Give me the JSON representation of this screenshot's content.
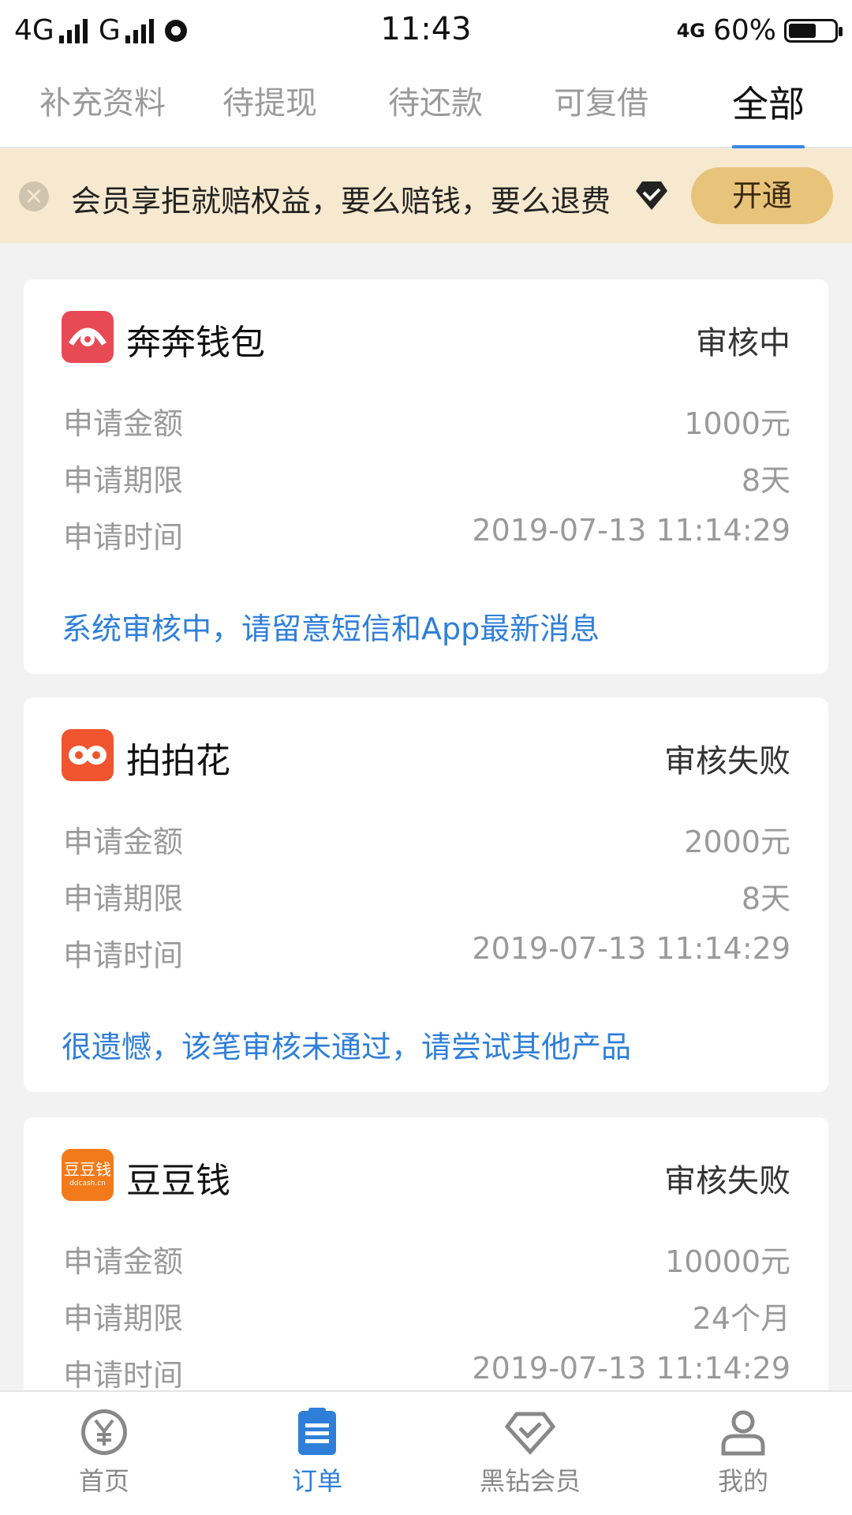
{
  "status_bar": {
    "network_left": "4G",
    "network_mid": "G",
    "time": "11:43",
    "network_right": "4G",
    "battery": "60%",
    "battery_level": 0.6
  },
  "tabs": [
    {
      "label": "补充资料",
      "active": false
    },
    {
      "label": "待提现",
      "active": false
    },
    {
      "label": "待还款",
      "active": false
    },
    {
      "label": "可复借",
      "active": false
    },
    {
      "label": "全部",
      "active": true
    }
  ],
  "banner": {
    "text": "会员享拒就赔权益，要么赔钱，要么退费",
    "button": "开通",
    "close_icon": "close-icon",
    "diamond_icon": "diamond-icon"
  },
  "orders": [
    {
      "name": "奔奔钱包",
      "status": "审核中",
      "logo_color": "#e84a55",
      "rows": [
        {
          "label": "申请金额",
          "value": "1000元"
        },
        {
          "label": "申请期限",
          "value": "8天"
        },
        {
          "label": "申请时间",
          "value": "2019-07-13 11:14:29"
        }
      ],
      "message": "系统审核中，请留意短信和App最新消息"
    },
    {
      "name": "拍拍花",
      "status": "审核失败",
      "logo_color": "#f0552f",
      "rows": [
        {
          "label": "申请金额",
          "value": "2000元"
        },
        {
          "label": "申请期限",
          "value": "8天"
        },
        {
          "label": "申请时间",
          "value": "2019-07-13 11:14:29"
        }
      ],
      "message": "很遗憾，该笔审核未通过，请尝试其他产品"
    },
    {
      "name": "豆豆钱",
      "status": "审核失败",
      "logo_color": "#f27a1a",
      "logo_text": "豆豆钱",
      "logo_subtext": "ddcash.cn",
      "rows": [
        {
          "label": "申请金额",
          "value": "10000元"
        },
        {
          "label": "申请期限",
          "value": "24个月"
        },
        {
          "label": "申请时间",
          "value": "2019-07-13 11:14:29"
        }
      ]
    }
  ],
  "bottom_nav": [
    {
      "label": "首页",
      "icon": "yen-icon",
      "active": false
    },
    {
      "label": "订单",
      "icon": "orders-clipboard-icon",
      "active": true
    },
    {
      "label": "黑钻会员",
      "icon": "diamond-icon",
      "active": false
    },
    {
      "label": "我的",
      "icon": "profile-icon",
      "active": false
    }
  ],
  "colors": {
    "accent": "#2f7fd9",
    "tab_underline": "#3a86e8",
    "banner_bg": "#f6e9cf",
    "banner_button": "#e8c37a"
  }
}
